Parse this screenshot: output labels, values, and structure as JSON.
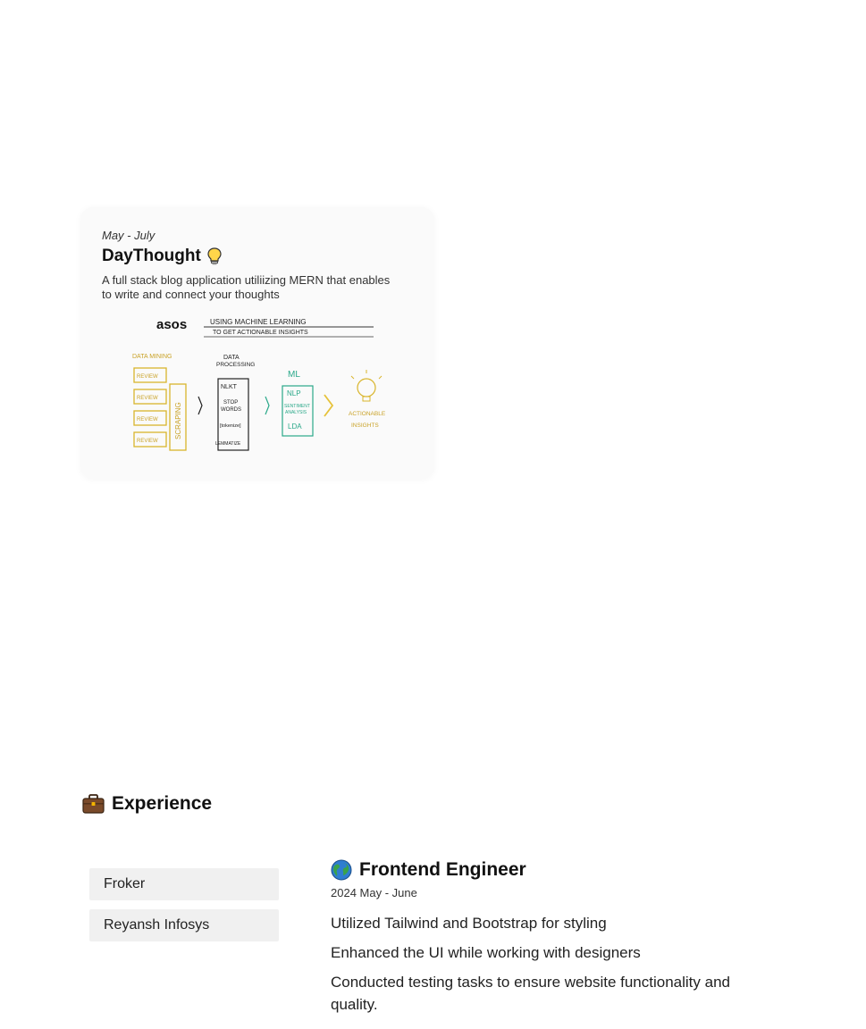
{
  "project": {
    "date": "May - July",
    "title": "DayThought",
    "icon": "lightbulb-icon",
    "description": "A full stack blog application utiliizing MERN that enables to write and connect your thoughts",
    "image": {
      "brand": "asos",
      "headline_1": "USING MACHINE LEARNING",
      "headline_2": "TO GET ACTIONABLE INSIGHTS",
      "stage_1_title": "DATA MINING",
      "stage_1_items": [
        "REVIEW",
        "REVIEW",
        "REVIEW",
        "REVIEW"
      ],
      "stage_1_side": "SCRAPING",
      "stage_2_title_1": "DATA",
      "stage_2_title_2": "PROCESSING",
      "stage_2_items": [
        "NLKT",
        "STOP",
        "WORDS",
        "[tokenize]",
        "LEMMATIZE"
      ],
      "stage_3_title": "ML",
      "stage_3_items": [
        "NLP",
        "SENTIMENT",
        "ANALYSIS",
        "LDA"
      ],
      "stage_4_1": "ACTIONABLE",
      "stage_4_2": "INSIGHTS"
    }
  },
  "experience": {
    "heading": "Experience",
    "icon": "briefcase-icon",
    "companies": [
      {
        "name": "Froker"
      },
      {
        "name": "Reyansh Infosys"
      }
    ],
    "role": {
      "icon": "globe-icon",
      "title": "Frontend Engineer",
      "dates": "2024 May - June",
      "duties": [
        "Utilized Tailwind and Bootstrap for styling",
        "Enhanced the UI while working with designers",
        "Conducted testing tasks to ensure website functionality and quality."
      ]
    }
  }
}
